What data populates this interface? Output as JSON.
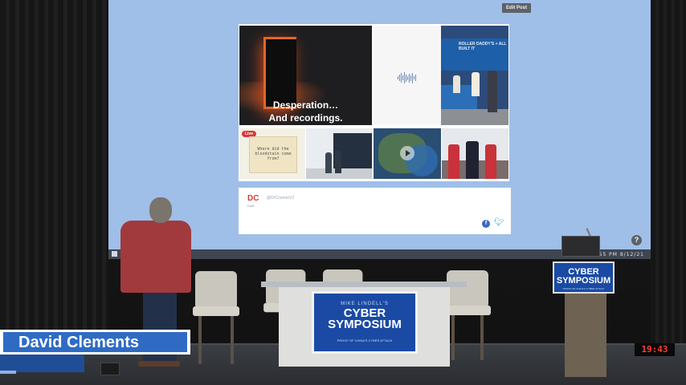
{
  "stage": {
    "screen_color": "#9fbfe9",
    "edit_button_label": "Edit Post",
    "help_icon_label": "?",
    "taskbar_clock": "9:55 PM  8/12/21",
    "slide": {
      "main_caption_line1": "Desperation…",
      "main_caption_line2": "And recordings.",
      "tile2_header": "",
      "tile3_banner": "ROLLER DADDY'S + ALL BUILT IT",
      "tile4_text": "Where did the bloodstain come from?",
      "tile4_badge": "Live",
      "footer_logo": "DC",
      "footer_logo_sub": "CAN",
      "footer_handle": "@DrCoomerV2"
    }
  },
  "set": {
    "desk_kicker": "MIKE LINDELL'S",
    "desk_title_line1": "CYBER",
    "desk_title_line2": "SYMPOSIUM",
    "desk_tagline": "PROOF OF CHINA'S CYBER ATTACK",
    "podium_title_line1": "CYBER",
    "podium_title_line2": "SYMPOSIUM",
    "podium_tagline": "PROOF OF CHINA'S CYBER ATTACK",
    "clock_display": "19:43"
  },
  "overlay": {
    "speaker_name": "David Clements",
    "brand_color": "#2f6bc4"
  },
  "icons": [
    "windows-logo-icon",
    "help-icon",
    "facebook-icon",
    "twitter-icon",
    "play-icon"
  ]
}
